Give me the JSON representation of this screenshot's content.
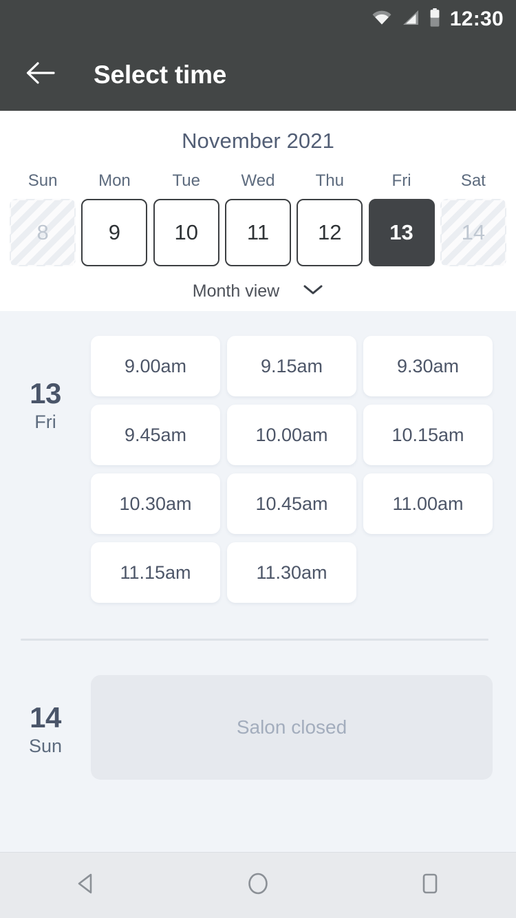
{
  "status_bar": {
    "time": "12:30",
    "icons": [
      "wifi-icon",
      "signal-icon",
      "battery-icon"
    ]
  },
  "app_bar": {
    "back_icon": "arrow-left-icon",
    "title": "Select time"
  },
  "calendar": {
    "month_title": "November 2021",
    "weekdays": [
      "Sun",
      "Mon",
      "Tue",
      "Wed",
      "Thu",
      "Fri",
      "Sat"
    ],
    "days": [
      {
        "number": "8",
        "state": "disabled"
      },
      {
        "number": "9",
        "state": "available"
      },
      {
        "number": "10",
        "state": "available"
      },
      {
        "number": "11",
        "state": "available"
      },
      {
        "number": "12",
        "state": "available"
      },
      {
        "number": "13",
        "state": "selected"
      },
      {
        "number": "14",
        "state": "disabled"
      }
    ],
    "view_toggle": {
      "label": "Month view",
      "icon": "chevron-down-icon"
    }
  },
  "schedule": {
    "groups": [
      {
        "day_number": "13",
        "day_name": "Fri",
        "slots": [
          "9.00am",
          "9.15am",
          "9.30am",
          "9.45am",
          "10.00am",
          "10.15am",
          "10.30am",
          "10.45am",
          "11.00am",
          "11.15am",
          "11.30am"
        ]
      },
      {
        "day_number": "14",
        "day_name": "Sun",
        "closed_message": "Salon closed"
      }
    ]
  },
  "nav_bar": {
    "back": "back-triangle-icon",
    "home": "home-circle-icon",
    "recents": "recents-square-icon"
  },
  "colors": {
    "app_bar": "#434646",
    "selected_day": "#414447",
    "page_background": "#f1f4f8",
    "slot_card": "#ffffff",
    "closed_card": "#e6e9ee",
    "accent_text": "#4a5569"
  }
}
